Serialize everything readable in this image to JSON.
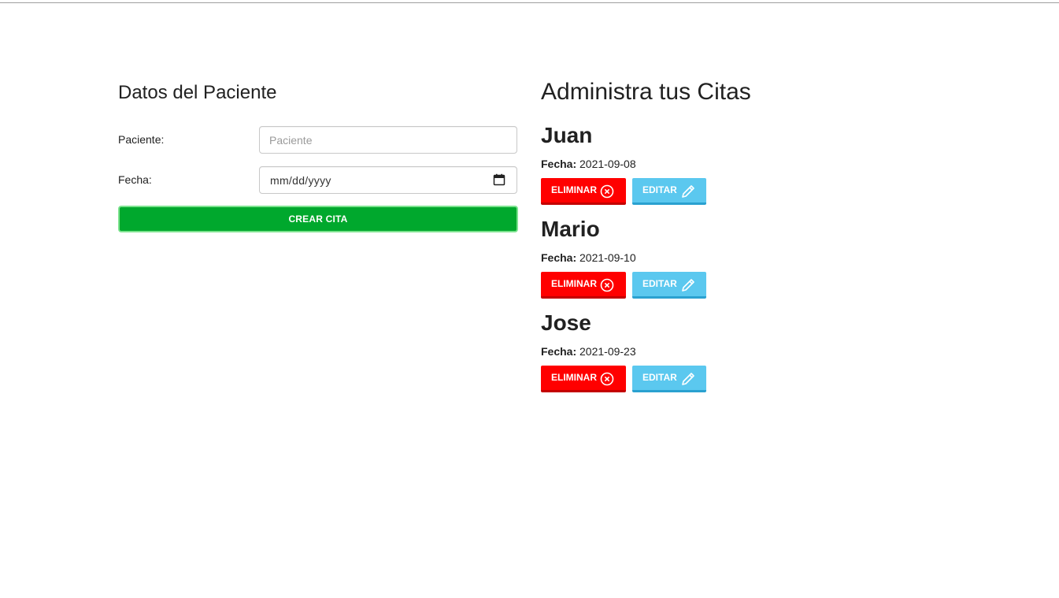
{
  "form": {
    "title": "Datos del Paciente",
    "paciente_label": "Paciente:",
    "paciente_placeholder": "Paciente",
    "fecha_label": "Fecha:",
    "fecha_value": "mm/dd/yyyy",
    "submit_label": "CREAR CITA"
  },
  "citas": {
    "title": "Administra tus Citas",
    "fecha_label": "Fecha:",
    "delete_label": "ELIMINAR",
    "edit_label": "EDITAR",
    "items": [
      {
        "nombre": "Juan",
        "fecha": "2021-09-08"
      },
      {
        "nombre": "Mario",
        "fecha": "2021-09-10"
      },
      {
        "nombre": "Jose",
        "fecha": "2021-09-23"
      }
    ]
  },
  "colors": {
    "create_button": "#00a82d",
    "delete_button": "#ff0000",
    "edit_button": "#5bc8ef"
  },
  "icons": {
    "delete": "x-circle-icon",
    "edit": "pencil-icon",
    "date_picker": "calendar-icon"
  }
}
